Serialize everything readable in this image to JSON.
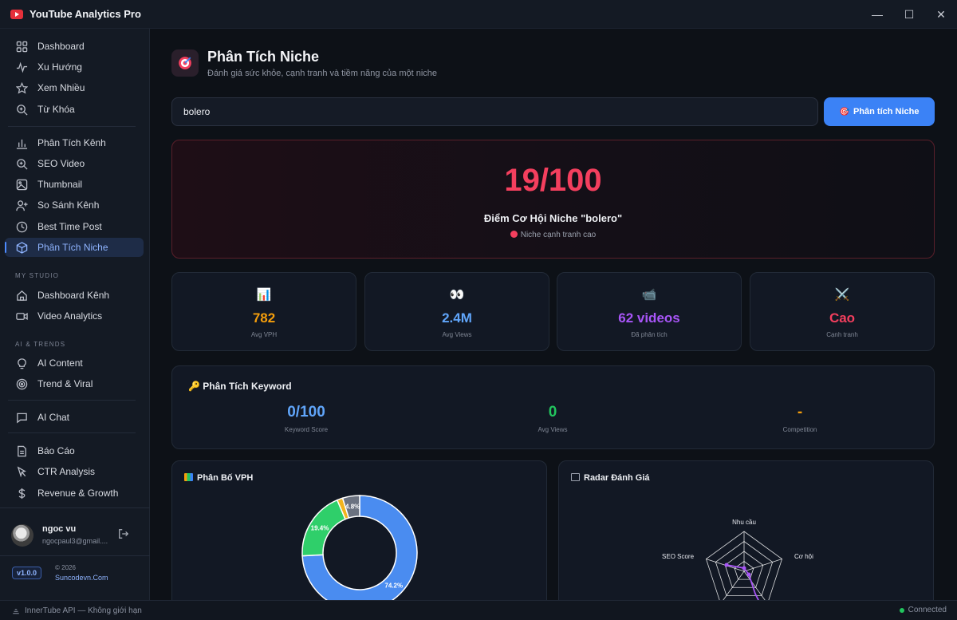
{
  "app": {
    "title": "YouTube Analytics Pro"
  },
  "window": {
    "minimize": "—",
    "maximize": "☐",
    "close": "✕"
  },
  "sidebar": {
    "group1": [
      {
        "label": "Dashboard",
        "icon": "grid-icon"
      },
      {
        "label": "Xu Hướng",
        "icon": "trend-icon"
      },
      {
        "label": "Xem Nhiều",
        "icon": "star-icon"
      },
      {
        "label": "Từ Khóa",
        "icon": "search-plus-icon"
      }
    ],
    "group2": [
      {
        "label": "Phân Tích Kênh",
        "icon": "bar-chart-icon"
      },
      {
        "label": "SEO Video",
        "icon": "zoom-icon"
      },
      {
        "label": "Thumbnail",
        "icon": "image-icon"
      },
      {
        "label": "So Sánh Kênh",
        "icon": "user-plus-icon"
      },
      {
        "label": "Best Time Post",
        "icon": "clock-icon"
      },
      {
        "label": "Phân Tích Niche",
        "icon": "cube-icon",
        "active": true
      }
    ],
    "section_studio": "MY STUDIO",
    "group3": [
      {
        "label": "Dashboard Kênh",
        "icon": "home-icon"
      },
      {
        "label": "Video Analytics",
        "icon": "video-icon"
      }
    ],
    "section_ai": "AI & TRENDS",
    "group4": [
      {
        "label": "AI Content",
        "icon": "bulb-icon"
      },
      {
        "label": "Trend & Viral",
        "icon": "target-icon"
      }
    ],
    "group5": [
      {
        "label": "AI Chat",
        "icon": "chat-icon"
      }
    ],
    "group6": [
      {
        "label": "Báo Cáo",
        "icon": "document-icon"
      },
      {
        "label": "CTR Analysis",
        "icon": "cursor-icon"
      },
      {
        "label": "Revenue & Growth",
        "icon": "dollar-icon"
      }
    ],
    "user": {
      "name": "ngoc vu",
      "email": "ngocpaul3@gmail...."
    },
    "version": "v1.0.0",
    "copyright": "© 2026",
    "site": "Suncodevn.Com"
  },
  "status": {
    "left": "InnerTube API — Không giới hạn",
    "right": "Connected"
  },
  "page": {
    "title": "Phân Tích Niche",
    "subtitle": "Đánh giá sức khỏe, cạnh tranh và tiềm năng của một niche",
    "search_value": "bolero",
    "analyze_label": "Phân tích Niche",
    "analyze_icon": "🎯"
  },
  "score": {
    "value": "19/100",
    "title": "Điểm Cơ Hội Niche \"bolero\"",
    "note": "Niche cạnh tranh cao",
    "color": "#f43f5e"
  },
  "stats": [
    {
      "icon": "📊",
      "value": "782",
      "label": "Avg VPH",
      "color": "#f59e0b"
    },
    {
      "icon": "👀",
      "value": "2.4M",
      "label": "Avg Views",
      "color": "#60a5fa"
    },
    {
      "icon": "📹",
      "value": "62 videos",
      "label": "Đã phân tích",
      "color": "#a855f7"
    },
    {
      "icon": "⚔️",
      "value": "Cao",
      "label": "Cạnh tranh",
      "color": "#f43f5e"
    }
  ],
  "keyword": {
    "title": "🔑 Phân Tích Keyword",
    "items": [
      {
        "value": "0/100",
        "label": "Keyword Score",
        "color": "#60a5fa"
      },
      {
        "value": "0",
        "label": "Avg Views",
        "color": "#22c55e"
      },
      {
        "value": "-",
        "label": "Competition",
        "color": "#f59e0b"
      }
    ]
  },
  "vph_panel": {
    "title": "Phân Bố VPH"
  },
  "radar_panel": {
    "title": "Radar Đánh Giá"
  },
  "chart_data": [
    {
      "type": "pie",
      "title": "Phân Bố VPH",
      "slices": [
        {
          "value": 74.2,
          "label": "74.2%",
          "color": "#4a8cf0"
        },
        {
          "value": 19.4,
          "label": "19.4%",
          "color": "#2fcf6a"
        },
        {
          "value": 1.6,
          "label": "",
          "color": "#f2b41d"
        },
        {
          "value": 4.8,
          "label": "4.8%",
          "color": "#6b7280"
        }
      ]
    },
    {
      "type": "radar",
      "title": "Radar Đánh Giá",
      "axes": [
        "Nhu cầu",
        "Cơ hội",
        "",
        "",
        "SEO Score"
      ]
    }
  ]
}
